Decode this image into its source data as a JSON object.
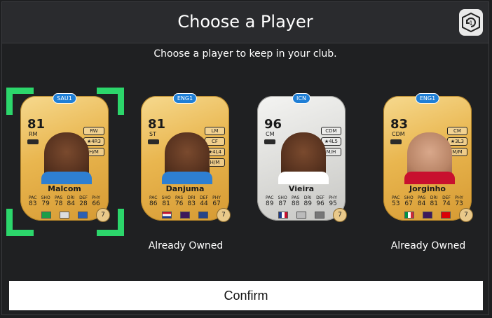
{
  "header": {
    "title": "Choose a Player"
  },
  "subtitle": "Choose a player to keep in your club.",
  "cards": [
    {
      "league": "SAU1",
      "rating": "81",
      "position": "RM",
      "name": "Malcom",
      "chips": [
        "RW",
        "★4R3",
        "H/M"
      ],
      "stats": {
        "labels": [
          "PAC",
          "SHO",
          "PAS",
          "DRI",
          "DEF",
          "PHY"
        ],
        "values": [
          "83",
          "79",
          "78",
          "84",
          "28",
          "66"
        ]
      },
      "chemistry": "7",
      "owned": ""
    },
    {
      "league": "ENG1",
      "rating": "81",
      "position": "ST",
      "name": "Danjuma",
      "chips": [
        "LM",
        "CF",
        "★4L4",
        "H/M"
      ],
      "stats": {
        "labels": [
          "PAC",
          "SHO",
          "PAS",
          "DRI",
          "DEF",
          "PHY"
        ],
        "values": [
          "86",
          "81",
          "76",
          "83",
          "44",
          "67"
        ]
      },
      "chemistry": "7",
      "owned": "Already Owned"
    },
    {
      "league": "ICN",
      "rating": "96",
      "position": "CM",
      "name": "Vieira",
      "chips": [
        "CDM",
        "★4L5",
        "M/H"
      ],
      "stats": {
        "labels": [
          "PAC",
          "SHO",
          "PAS",
          "DRI",
          "DEF",
          "PHY"
        ],
        "values": [
          "89",
          "87",
          "88",
          "89",
          "96",
          "95"
        ]
      },
      "chemistry": "7",
      "owned": ""
    },
    {
      "league": "ENG1",
      "rating": "83",
      "position": "CDM",
      "name": "Jorginho",
      "chips": [
        "CM",
        "★3L3",
        "M/M"
      ],
      "stats": {
        "labels": [
          "PAC",
          "SHO",
          "PAS",
          "DRI",
          "DEF",
          "PHY"
        ],
        "values": [
          "53",
          "67",
          "84",
          "81",
          "74",
          "73"
        ]
      },
      "chemistry": "7",
      "owned": "Already Owned"
    }
  ],
  "confirm_label": "Confirm",
  "colors": {
    "selection": "#2cd66b",
    "background": "#1f2022",
    "header": "#2a2b2e"
  }
}
